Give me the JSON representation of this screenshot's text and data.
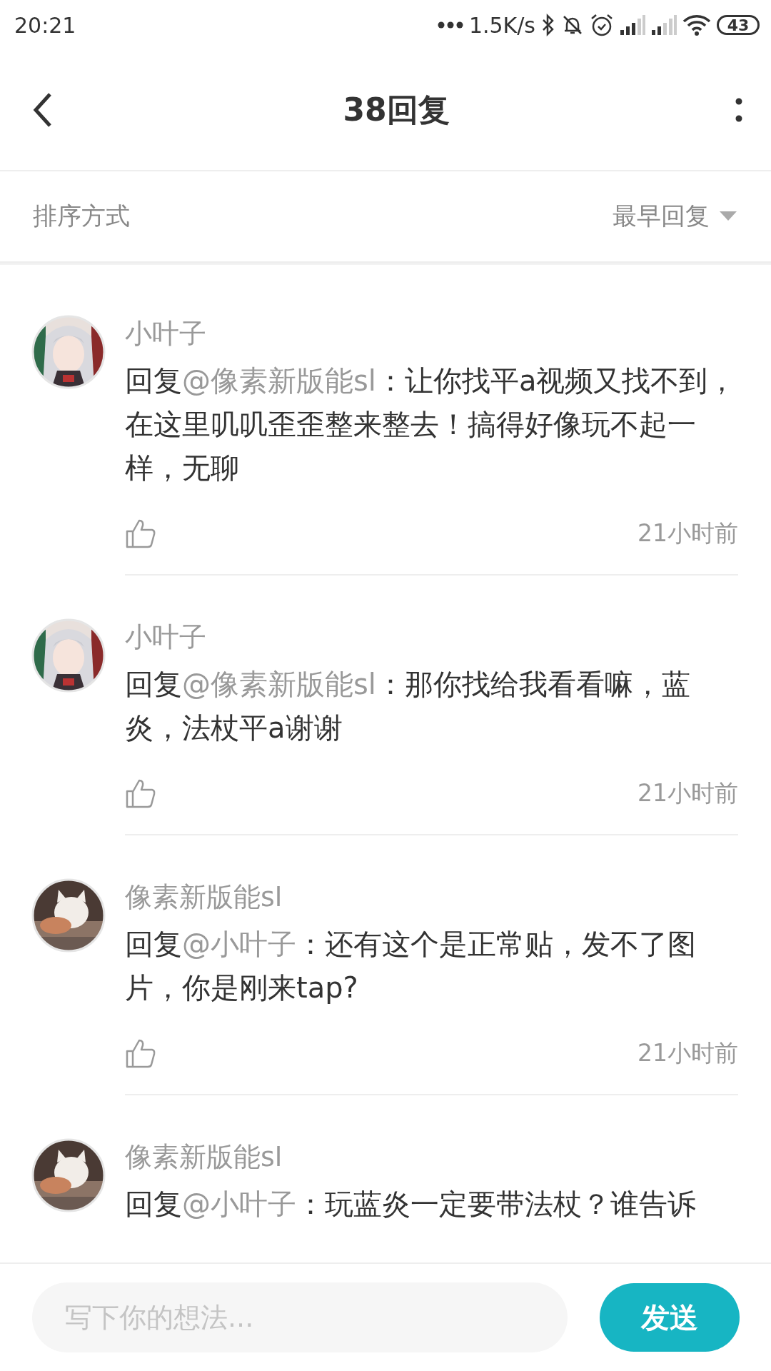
{
  "status_bar": {
    "time": "20:21",
    "speed": "1.5K/s",
    "battery": "43"
  },
  "header": {
    "title": "38回复"
  },
  "sort": {
    "label": "排序方式",
    "value": "最早回复"
  },
  "comments": [
    {
      "name": "小叶子",
      "prefix": "回复",
      "mention": "@像素新版能sl",
      "body": "：让你找平a视频又找不到，在这里叽叽歪歪整来整去！搞得好像玩不起一样，无聊",
      "time": "21小时前"
    },
    {
      "name": "小叶子",
      "prefix": "回复",
      "mention": "@像素新版能sl",
      "body": "：那你找给我看看嘛，蓝炎，法杖平a谢谢",
      "time": "21小时前"
    },
    {
      "name": "像素新版能sl",
      "prefix": "回复",
      "mention": "@小叶子",
      "body": "：还有这个是正常贴，发不了图片，你是刚来tap?",
      "time": "21小时前"
    },
    {
      "name": "像素新版能sl",
      "prefix": "回复",
      "mention": "@小叶子",
      "body": "：玩蓝炎一定要带法杖？谁告诉"
    }
  ],
  "reply_bar": {
    "placeholder": "写下你的想法...",
    "send": "发送"
  }
}
